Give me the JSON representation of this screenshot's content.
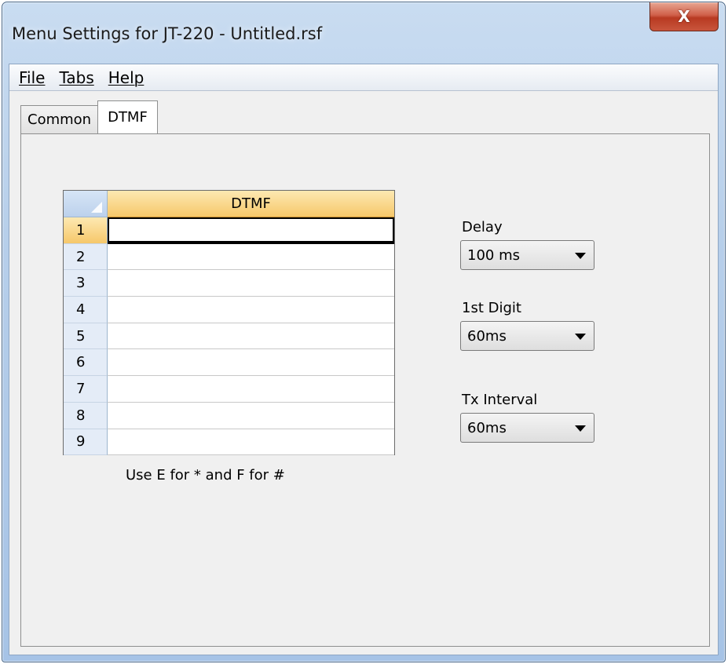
{
  "window": {
    "title": "Menu Settings for JT-220 - Untitled.rsf",
    "close_label": "X"
  },
  "menu": {
    "items": [
      "File",
      "Tabs",
      "Help"
    ]
  },
  "tabs": [
    {
      "label": "Common",
      "active": false
    },
    {
      "label": "DTMF",
      "active": true
    }
  ],
  "grid": {
    "column_header": "DTMF",
    "rows": [
      "1",
      "2",
      "3",
      "4",
      "5",
      "6",
      "7",
      "8",
      "9"
    ],
    "selected_row": "1",
    "hint": "Use E for * and F for #"
  },
  "settings": {
    "delay": {
      "label": "Delay",
      "value": "100 ms"
    },
    "first_digit": {
      "label": "1st Digit",
      "value": "60ms"
    },
    "tx_interval": {
      "label": "Tx Interval",
      "value": "60ms"
    }
  },
  "colors": {
    "header_accent": "#f6c86a",
    "close_button": "#c8553c"
  },
  "icons": {
    "close": "close-icon",
    "dropdown": "chevron-down-icon"
  }
}
